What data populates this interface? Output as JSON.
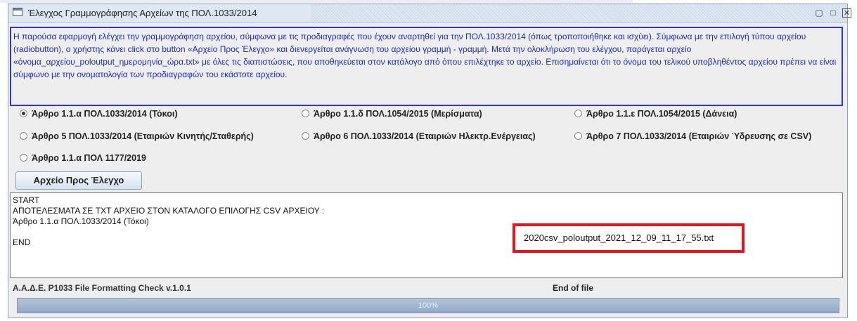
{
  "window": {
    "title": "Έλεγχος Γραμμογράφησης Αρχείων της ΠΟΛ.1033/2014",
    "controls": [
      "minimize-icon",
      "maximize-icon",
      "close-icon"
    ]
  },
  "description": {
    "text": "Η παρούσα εφαρμογή ελέγχει την γραμμογράφηση αρχείου, σύμφωνα με τις προδιαγραφές που έχουν αναρτηθεί για την ΠΟΛ.1033/2014 (όπως τροποποιήθηκε και ισχύει). Σύμφωνα με την επιλογή τύπου αρχείου (radiobutton), ο χρήστης κάνει click στο button «Αρχείο Προς Έλεγχο» και διενεργείται ανάγνωση του αρχείου γραμμή - γραμμή. Μετά την ολοκλήρωση του ελέγχου, παράγεται αρχείο «όνομα_αρχείου_poloutput_ημερομηνία_ώρα.txt» με όλες τις διαπιστώσεις, που αποθηκεύεται στον κατάλογο από όπου επιλέχτηκε το αρχείο. Επισημαίνεται ότι το όνομα του τελικού υποβληθέντος αρχείου πρέπει να είναι σύμφωνο με την ονοματολογία των προδιαγραφών του εκάστοτε αρχείου.",
    "color": "#1a2bc4"
  },
  "options": [
    {
      "label": "Άρθρο 1.1.α ΠΟΛ.1033/2014 (Τόκοι)",
      "selected": true
    },
    {
      "label": "Άρθρο 1.1.δ ΠΟΛ.1054/2015 (Μερίσματα)",
      "selected": false
    },
    {
      "label": "Άρθρο 1.1.ε ΠΟΛ.1054/2015 (Δάνεια)",
      "selected": false
    },
    {
      "label": "Άρθρο 5 ΠΟΛ.1033/2014 (Εταιριών Κινητής/Σταθερής)",
      "selected": false
    },
    {
      "label": "Άρθρο 6 ΠΟΛ.1033/2014 (Εταιριών Ηλεκτρ.Ενέργειας)",
      "selected": false
    },
    {
      "label": "Άρθρο 7 ΠΟΛ.1033/2014 (Εταιριών Ύδρευσης σε CSV)",
      "selected": false
    },
    {
      "label": "Άρθρο 1.1.α ΠΟΛ 1177/2019",
      "selected": false
    }
  ],
  "check_button": {
    "label": "Αρχείο Προς Έλεγχο"
  },
  "output": {
    "lines": [
      "START",
      "ΑΠΟΤΕΛΕΣΜΑΤΑ ΣΕ TXT ΑΡΧΕΙΟ ΣΤΟΝ ΚΑΤΑΛΟΓΟ ΕΠΙΛΟΓΗΣ CSV ΑΡΧΕΙΟΥ :",
      "Άρθρο 1.1.α ΠΟΛ.1033/2014 (Τόκοι)",
      "",
      "END"
    ],
    "highlighted_filename": "2020csv_poloutput_2021_12_09_11_17_55.txt",
    "highlight_color": "#e8141c"
  },
  "status": {
    "left": "Α.Α.Δ.Ε. P1033 File Formatting Check v.1.0.1",
    "right": "End of file"
  },
  "progress": {
    "value": 100,
    "label": "100%"
  }
}
